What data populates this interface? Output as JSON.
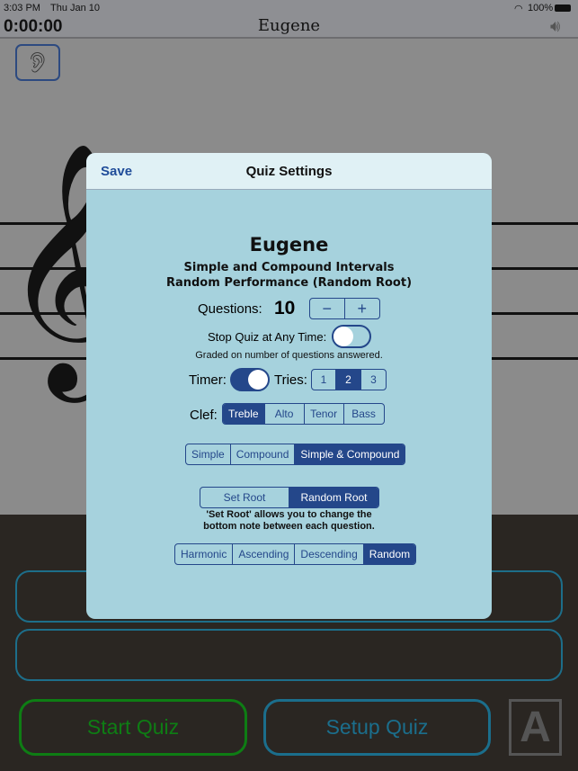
{
  "status": {
    "time": "3:03 PM",
    "date": "Thu Jan 10",
    "battery": "100%"
  },
  "header": {
    "timer": "0:00:00",
    "title": "Eugene",
    "sound_icon": "speaker-icon",
    "ear_icon": "ear-icon"
  },
  "modal": {
    "save": "Save",
    "title": "Quiz Settings",
    "name": "Eugene",
    "line1": "Simple and Compound Intervals",
    "line2": "Random Performance (Random Root)",
    "questions_label": "Questions:",
    "questions": "10",
    "minus": "−",
    "plus": "+",
    "stop_label": "Stop Quiz at Any Time:",
    "stop_on": false,
    "graded": "Graded on number of questions answered.",
    "timer_label": "Timer:",
    "timer_on": true,
    "tries_label": "Tries:",
    "tries": [
      "1",
      "2",
      "3"
    ],
    "tries_selected": "2",
    "clef_label": "Clef:",
    "clefs": [
      "Treble",
      "Alto",
      "Tenor",
      "Bass"
    ],
    "clef_selected": "Treble",
    "types": [
      "Simple",
      "Compound",
      "Simple & Compound"
    ],
    "type_selected": "Simple & Compound",
    "roots": [
      "Set Root",
      "Random Root"
    ],
    "root_selected": "Random Root",
    "root_note": "'Set Root' allows you to change the",
    "root_note2": "bottom note between each question.",
    "modes": [
      "Harmonic",
      "Ascending",
      "Descending",
      "Random"
    ],
    "mode_selected": "Random"
  },
  "buttons": {
    "start": "Start Quiz",
    "setup": "Setup Quiz",
    "logo": "A"
  },
  "colors": {
    "accent": "#24478a",
    "start": "#0e7d14",
    "setup": "#1b6e8c"
  }
}
